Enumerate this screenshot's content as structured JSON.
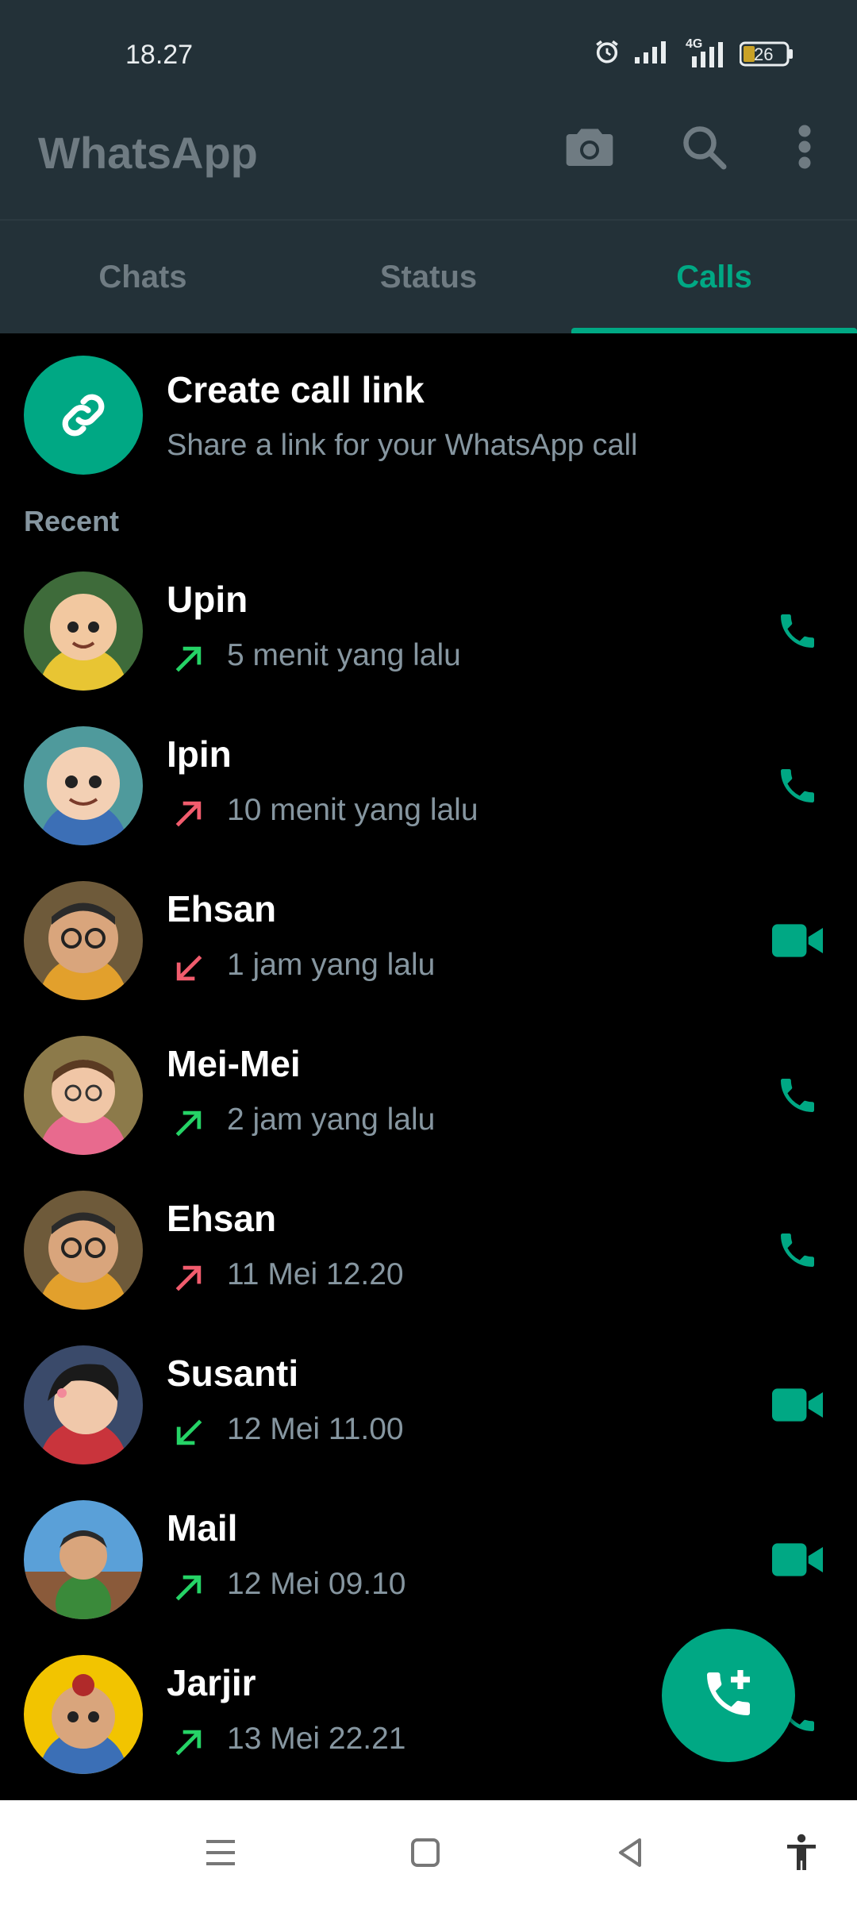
{
  "status_bar": {
    "time": "18.27",
    "network_label": "4G",
    "battery_level": "26",
    "icons": [
      "alarm-icon",
      "signal-icon",
      "signal-4g-icon",
      "battery-icon"
    ]
  },
  "app_bar": {
    "title": "WhatsApp",
    "icons": [
      "camera-icon",
      "search-icon",
      "more-vertical-icon"
    ]
  },
  "tabs": [
    {
      "label": "Chats",
      "active": false
    },
    {
      "label": "Status",
      "active": false
    },
    {
      "label": "Calls",
      "active": true
    }
  ],
  "create_call_link": {
    "title": "Create call link",
    "subtitle": "Share a link for your WhatsApp call",
    "icon": "link-icon"
  },
  "recent_label": "Recent",
  "calls": [
    {
      "name": "Upin",
      "time": "5 menit yang lalu",
      "direction": "outgoing",
      "status_color": "#25d366",
      "type": "voice"
    },
    {
      "name": "Ipin",
      "time": "10 menit yang lalu",
      "direction": "outgoing",
      "status_color": "#f15c6d",
      "type": "voice"
    },
    {
      "name": "Ehsan",
      "time": "1 jam yang lalu",
      "direction": "incoming",
      "status_color": "#f15c6d",
      "type": "video"
    },
    {
      "name": "Mei-Mei",
      "time": "2 jam yang lalu",
      "direction": "outgoing",
      "status_color": "#25d366",
      "type": "voice"
    },
    {
      "name": "Ehsan",
      "time": "11 Mei 12.20",
      "direction": "outgoing",
      "status_color": "#f15c6d",
      "type": "voice"
    },
    {
      "name": "Susanti",
      "time": "12 Mei 11.00",
      "direction": "incoming",
      "status_color": "#25d366",
      "type": "video"
    },
    {
      "name": "Mail",
      "time": "12 Mei 09.10",
      "direction": "outgoing",
      "status_color": "#25d366",
      "type": "video"
    },
    {
      "name": "Jarjir",
      "time": "13 Mei 22.21",
      "direction": "outgoing",
      "status_color": "#25d366",
      "type": "voice"
    }
  ],
  "fab": {
    "icon": "add-call-icon"
  },
  "colors": {
    "accent": "#00a884",
    "header": "#233138",
    "muted": "#8696a0",
    "missed": "#f15c6d",
    "ok": "#25d366"
  },
  "nav_bar": {
    "icons": [
      "menu-icon",
      "home-icon",
      "back-icon",
      "accessibility-icon"
    ]
  }
}
